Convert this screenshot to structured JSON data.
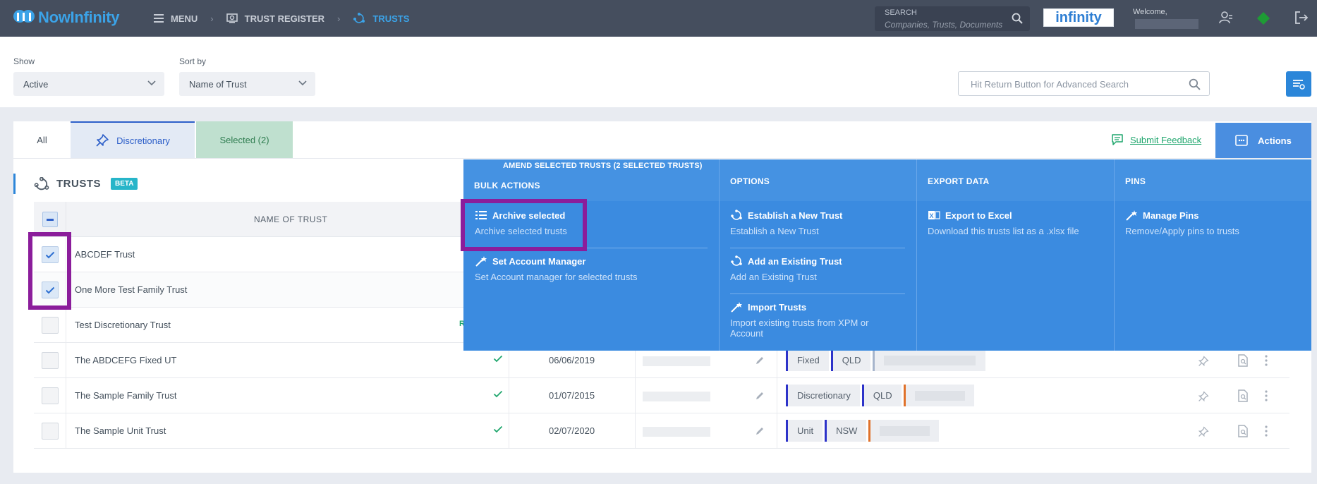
{
  "topbar": {
    "logo_text": "NowInfinity",
    "breadcrumb": [
      {
        "label": "MENU",
        "icon": "menu-icon"
      },
      {
        "label": "TRUST REGISTER",
        "icon": "register-icon"
      },
      {
        "label": "TRUSTS",
        "icon": "trusts-icon"
      }
    ],
    "search_label": "SEARCH",
    "search_placeholder": "Companies, Trusts, Documents",
    "partner_logo_text": "infinity",
    "welcome": "Welcome,"
  },
  "filters": {
    "show_label": "Show",
    "show_value": "Active",
    "sort_label": "Sort by",
    "sort_value": "Name of Trust",
    "advanced_search_placeholder": "Hit Return Button for Advanced Search"
  },
  "tabs": {
    "all": "All",
    "discretionary": "Discretionary",
    "selected": "Selected (2)"
  },
  "feedback_label": "Submit Feedback",
  "actions_label": "Actions",
  "section": {
    "title": "TRUSTS",
    "badge": "BETA"
  },
  "table": {
    "header_name": "NAME OF TRUST",
    "rows": [
      {
        "name": "ABCDEF Trust",
        "checked": true
      },
      {
        "name": "One More Test Family Trust",
        "checked": true
      },
      {
        "name": "Test Discretionary Trust",
        "checked": false,
        "cut_text": "R"
      },
      {
        "name": "The ABDCEFG Fixed UT",
        "checked": false,
        "date": "06/06/2019",
        "tags": [
          "Fixed",
          "QLD"
        ]
      },
      {
        "name": "The Sample Family Trust",
        "checked": false,
        "date": "01/07/2015",
        "tags": [
          "Discretionary",
          "QLD"
        ]
      },
      {
        "name": "The Sample Unit Trust",
        "checked": false,
        "date": "02/07/2020",
        "tags": [
          "Unit",
          "NSW"
        ]
      }
    ]
  },
  "actions_panel": {
    "header": "AMEND SELECTED TRUSTS (2 SELECTED TRUSTS)",
    "columns": {
      "bulk": "BULK ACTIONS",
      "options": "OPTIONS",
      "export": "EXPORT DATA",
      "pins": "PINS"
    },
    "bulk_items": [
      {
        "title": "Archive selected",
        "desc": "Archive selected trusts"
      },
      {
        "title": "Set Account Manager",
        "desc": "Set Account manager for selected trusts"
      }
    ],
    "option_items": [
      {
        "title": "Establish a New Trust",
        "desc": "Establish a New Trust"
      },
      {
        "title": "Add an Existing Trust",
        "desc": "Add an Existing Trust"
      },
      {
        "title": "Import Trusts",
        "desc": "Import existing trusts from XPM or Account"
      }
    ],
    "export_items": [
      {
        "title": "Export to Excel",
        "desc": "Download this trusts list as a .xlsx file"
      }
    ],
    "pin_items": [
      {
        "title": "Manage Pins",
        "desc": "Remove/Apply pins to trusts"
      }
    ]
  },
  "colors": {
    "topbar": "#454e5e",
    "accent": "#3ba3e8",
    "panel": "#3b8be0",
    "highlight": "#8b1d9b",
    "selected_tab": "#bfe0cf"
  }
}
